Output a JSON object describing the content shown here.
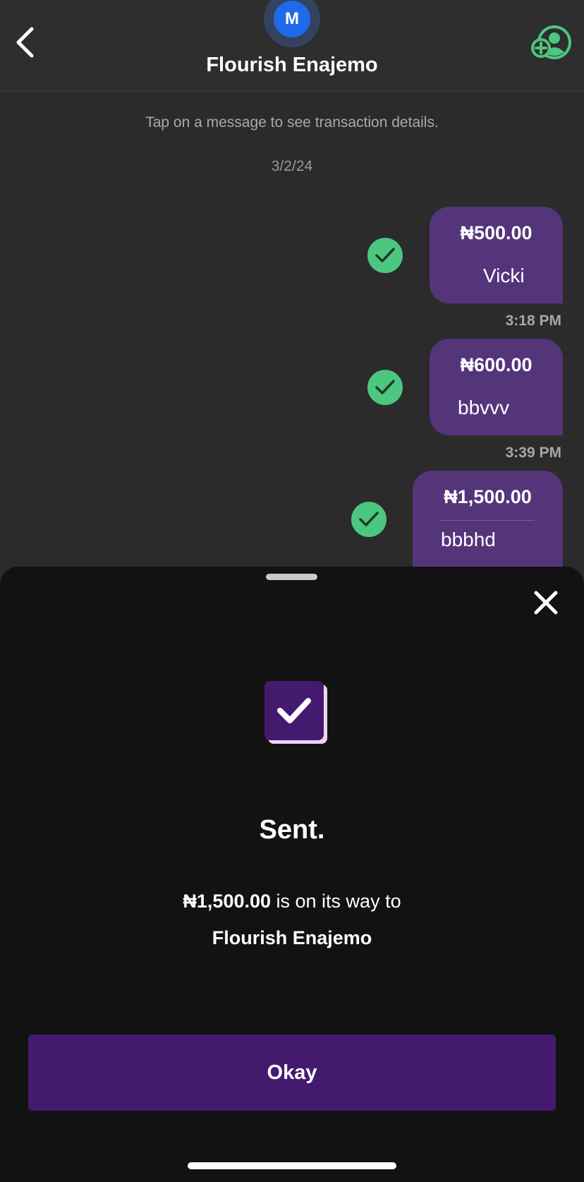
{
  "header": {
    "avatar_initial": "M",
    "contact_name": "Flourish Enajemo",
    "back_icon": "chevron-left-icon",
    "add_contact_icon": "add-user-icon",
    "accent_color": "#4cc77f"
  },
  "conversation": {
    "hint": "Tap on a message to see transaction details.",
    "date": "3/2/24",
    "messages": [
      {
        "amount": "₦500.00",
        "note": "Vicki",
        "status_icon": "check-icon",
        "time": "3:18 PM"
      },
      {
        "amount": "₦600.00",
        "note": "bbvvv",
        "status_icon": "check-icon",
        "time": "3:39 PM"
      },
      {
        "amount": "₦1,500.00",
        "note": "bbbhd",
        "status_icon": "check-icon"
      }
    ],
    "bubble_color": "#54357a"
  },
  "sheet": {
    "close_icon": "close-icon",
    "success_icon": "checkbox-checked-icon",
    "title": "Sent.",
    "amount": "₦1,500.00",
    "message_suffix": " is on its way to",
    "recipient": "Flourish Enajemo",
    "button_label": "Okay",
    "button_color": "#441a6e"
  }
}
